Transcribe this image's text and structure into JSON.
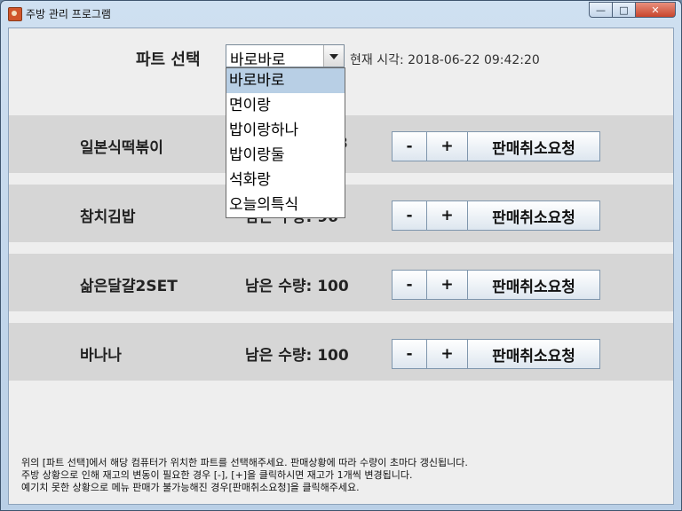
{
  "window": {
    "title": "주방 관리 프로그램"
  },
  "header": {
    "part_label": "파트 선택",
    "selected_part": "바로바로",
    "time_text": "현재 시각: 2018-06-22 09:42:20"
  },
  "dropdown": {
    "options": [
      "바로바로",
      "면이랑",
      "밥이랑하나",
      "밥이랑둘",
      "석화랑",
      "오늘의특식"
    ],
    "selected_index": 0
  },
  "items": [
    {
      "name": "일본식떡볶이",
      "stock": "3"
    },
    {
      "name": "참치김밥",
      "stock": "남은 수량: 96"
    },
    {
      "name": "삶은달걀2SET",
      "stock": "남은 수량: 100"
    },
    {
      "name": "바나나",
      "stock": "남은 수량: 100"
    }
  ],
  "buttons": {
    "minus": "-",
    "plus": "+",
    "cancel": "판매취소요청"
  },
  "footer": {
    "line1": "위의 [파트 선택]에서 해당 컴퓨터가 위치한 파트를 선택해주세요. 판매상황에 따라 수량이 초마다 갱신됩니다.",
    "line2": "주방 상황으로 인해 재고의 변동이 필요한 경우 [-], [+]을 클릭하시면 재고가 1개씩 변경됩니다.",
    "line3": "예기치 못한 상황으로 메뉴 판매가 불가능해진 경우[판매취소요청]을 클릭해주세요."
  }
}
